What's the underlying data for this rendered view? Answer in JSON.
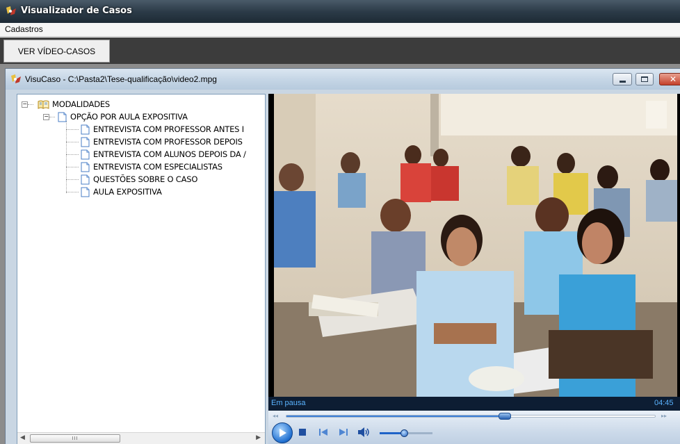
{
  "app": {
    "title": "Visualizador de Casos",
    "icon": "app-icon"
  },
  "menubar": {
    "items": [
      {
        "label": "Cadastros"
      }
    ]
  },
  "toolbar": {
    "tab_label": "VER VÍDEO-CASOS"
  },
  "child_window": {
    "title": "VisuCaso - C:\\Pasta2\\Tese-qualificação\\video2.mpg",
    "icon": "visucaso-icon",
    "controls": [
      "minimize-icon",
      "maximize-icon",
      "close-icon"
    ]
  },
  "tree": {
    "root": {
      "label": "MODALIDADES",
      "expander": "⊟",
      "icon": "book-icon"
    },
    "branch": {
      "label": "OPÇÃO POR AULA EXPOSITIVA",
      "expander": "⊟",
      "icon": "document-icon"
    },
    "leaves": [
      {
        "label": "ENTREVISTA COM PROFESSOR ANTES I"
      },
      {
        "label": "ENTREVISTA COM PROFESSOR DEPOIS"
      },
      {
        "label": "ENTREVISTA COM ALUNOS DEPOIS DA /"
      },
      {
        "label": "ENTREVISTA COM ESPECIALISTAS"
      },
      {
        "label": "QUESTÕES SOBRE O CASO"
      },
      {
        "label": "AULA EXPOSITIVA"
      }
    ],
    "scroll_grip": "III"
  },
  "player": {
    "status": "Em pausa",
    "time": "04:45",
    "seek_fraction": 0.59,
    "volume_fraction": 0.46,
    "colors": {
      "accent": "#3b7fd8",
      "status_text": "#5ab3ff"
    }
  }
}
